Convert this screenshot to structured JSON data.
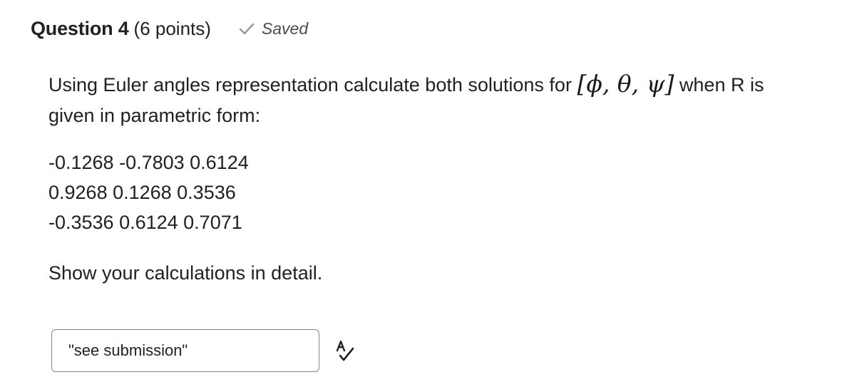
{
  "question": {
    "title": "Question 4",
    "points": "(6 points)",
    "status": "Saved",
    "prompt_part1": "Using Euler angles representation calculate both solutions for",
    "prompt_math": "[ϕ, θ, ψ]",
    "prompt_part2": "when R is",
    "prompt_line2": "given in parametric form:",
    "matrix_rows": [
      "-0.1268 -0.7803 0.6124",
      "0.9268 0.1268 0.3536",
      "-0.3536 0.6124 0.7071"
    ],
    "instruction": "Show your calculations in detail."
  },
  "answer": {
    "value": "\"see submission\""
  },
  "icons": {
    "status": "checkmark-icon",
    "tool": "spellcheck-icon"
  },
  "colors": {
    "text": "#202122",
    "muted": "#494c4e",
    "check": "#9a9a9a",
    "border": "#868686"
  }
}
